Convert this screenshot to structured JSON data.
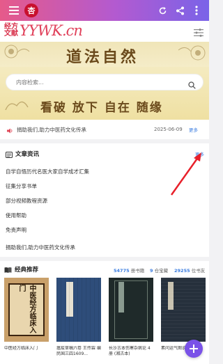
{
  "header": {
    "logo_cn_top": "杏",
    "logo_cn_line1": "经方",
    "logo_cn_line2": "文献",
    "logo_en": "YYWK.cn"
  },
  "banner": {
    "calligraphy_top": "道法自然",
    "calligraphy_bottom": "看破 放下 自在 随缘",
    "search_placeholder": "内容检索..."
  },
  "notice": {
    "text": "捐助我们,助力中医药文化传承",
    "date": "2025-06-09",
    "more": "更多"
  },
  "articles": {
    "title": "文章资讯",
    "more": "更多",
    "items": [
      "自学自悟历代名医大家自学成才汇集",
      "征集分享书单",
      "部分视频教程资源",
      "使用帮助",
      "免责声明",
      "捐助我们,助力中医药文化传承"
    ]
  },
  "classics": {
    "title": "经典推荐",
    "stats": [
      {
        "num": "54775",
        "label": "册书籍"
      },
      {
        "num": "9",
        "label": "仓宝藏"
      },
      {
        "num": "29255",
        "label": "位书友"
      }
    ],
    "books": [
      {
        "title": "中医经方临床入门",
        "cover": "中医经方临床入门"
      },
      {
        "title": "瘟疫草稿六卷 王传霖 编 民国三四1609...",
        "cover": ""
      },
      {
        "title": "长沙古本伤寒杂病论 4册 (湘古本)",
        "cover": ""
      },
      {
        "title": "素问运气图说 (清)...",
        "cover": ""
      },
      {
        "title": "灵广补注 (注-王冰)...",
        "cover": ""
      }
    ]
  },
  "colors": {
    "accent": "#3a7ce0",
    "fab": "#7a52e8",
    "topbar_start": "#e65a8a",
    "topbar_end": "#7a63e8"
  }
}
